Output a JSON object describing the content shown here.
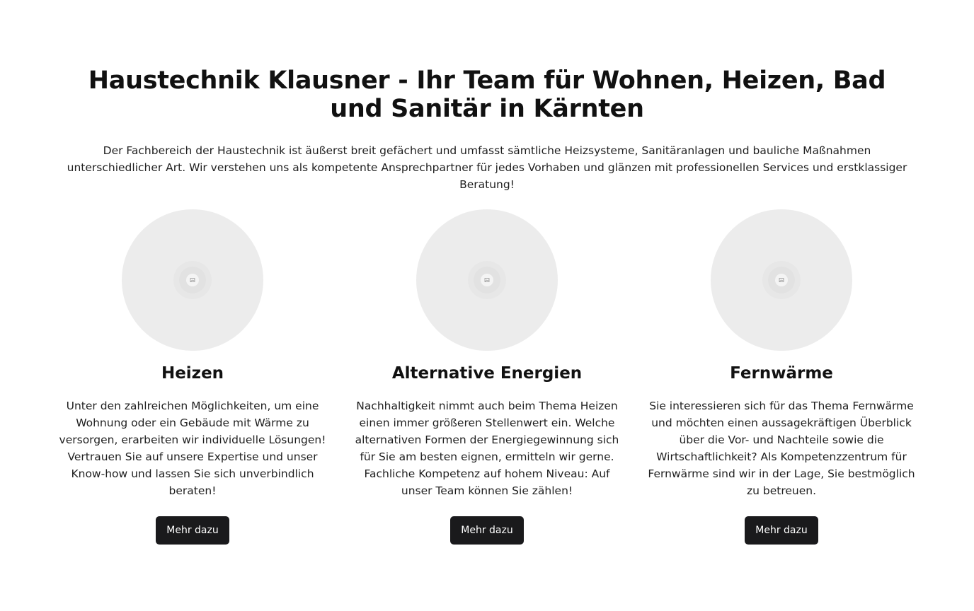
{
  "header": {
    "title": "Haustechnik Klausner - Ihr Team für Wohnen, Heizen, Bad und Sanitär in Kärnten",
    "intro": "Der Fachbereich der Haustechnik ist äußerst breit gefächert und umfasst sämtliche Heizsysteme, Sanitäranlagen und bauliche Maßnahmen unterschiedlicher Art. Wir verstehen uns als kompetente Ansprechpartner für jedes Vorhaben und glänzen mit professionellen Services und erstklassiger Beratung!"
  },
  "services": [
    {
      "title": "Heizen",
      "text": "Unter den zahlreichen Möglichkeiten, um eine Wohnung oder ein Gebäude mit Wärme zu versorgen, erarbeiten wir individuelle Lösungen! Vertrauen Sie auf unsere Expertise und unser Know-how und lassen Sie sich unverbindlich beraten!",
      "button": "Mehr dazu",
      "image_icon": "image-placeholder-icon"
    },
    {
      "title": "Alternative Energien",
      "text": "Nachhaltigkeit nimmt auch beim Thema Heizen einen immer größeren Stellenwert ein. Welche alternativen Formen der Energiegewinnung sich für Sie am besten eignen, ermitteln wir gerne. Fachliche Kompetenz auf hohem Niveau: Auf unser Team können Sie zählen!",
      "button": "Mehr dazu",
      "image_icon": "image-placeholder-icon"
    },
    {
      "title": "Fernwärme",
      "text": "Sie interessieren sich für das Thema Fernwärme und möchten einen aussagekräftigen Überblick über die Vor- und Nachteile sowie die Wirtschaftlichkeit? Als Kompetenzzentrum für Fernwärme sind wir in der Lage, Sie bestmöglich zu betreuen.",
      "button": "Mehr dazu",
      "image_icon": "image-placeholder-icon"
    }
  ],
  "colors": {
    "background": "#ffffff",
    "text": "#111111",
    "placeholder": "#ececec",
    "button_bg": "#1a1a1c",
    "button_text": "#ffffff"
  }
}
